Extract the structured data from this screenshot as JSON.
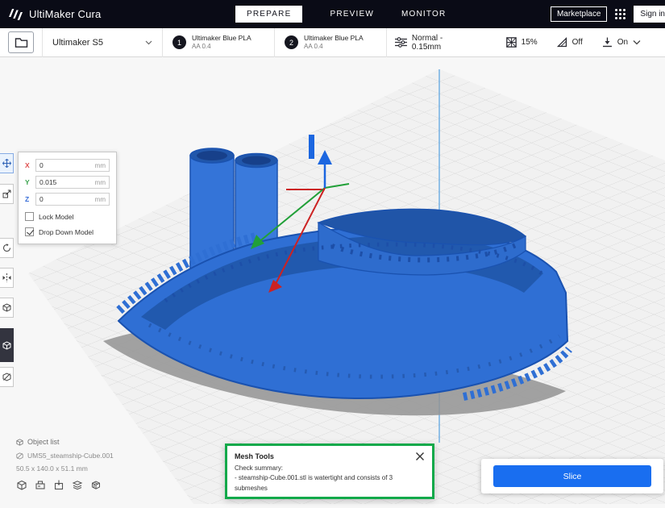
{
  "colors": {
    "accent": "#196ef0",
    "dialog_green": "#10a94a",
    "model_blue": "#2f6fd4",
    "header_bg": "#0a0b16"
  },
  "header": {
    "app_title": "UltiMaker Cura",
    "tabs": [
      {
        "label": "PREPARE",
        "active": true
      },
      {
        "label": "PREVIEW",
        "active": false
      },
      {
        "label": "MONITOR",
        "active": false
      }
    ],
    "marketplace_label": "Marketplace",
    "sign_in_label": "Sign in"
  },
  "toolbar": {
    "printer_name": "Ultimaker S5",
    "extruders": [
      {
        "number": "1",
        "material": "Ultimaker Blue PLA",
        "nozzle": "AA 0.4"
      },
      {
        "number": "2",
        "material": "Ultimaker Blue PLA",
        "nozzle": "AA 0.4"
      }
    ],
    "profile": "Normal - 0.15mm",
    "infill": "15%",
    "support": "Off",
    "adhesion": "On"
  },
  "move_panel": {
    "fields": [
      {
        "axis": "X",
        "value": "0",
        "unit": "mm"
      },
      {
        "axis": "Y",
        "value": "0.015",
        "unit": "mm"
      },
      {
        "axis": "Z",
        "value": "0",
        "unit": "mm"
      }
    ],
    "lock_model_label": "Lock Model",
    "drop_down_model_label": "Drop Down Model",
    "drop_down_checked": "checked"
  },
  "object_list": {
    "title": "Object list",
    "item_name": "UMS5_steamship-Cube.001",
    "dimensions": "50.5 x 140.0 x 51.1 mm"
  },
  "mesh_tools_dialog": {
    "title": "Mesh Tools",
    "summary_label": "Check summary:",
    "summary_line": "- steamship-Cube.001.stl is watertight and consists of 3 submeshes"
  },
  "slice_panel": {
    "slice_label": "Slice"
  },
  "icons": {
    "logo": "ultimaker-mark",
    "open_file": "folder",
    "profile": "sliders",
    "infill": "grid-square",
    "support": "overhang-triangle",
    "adhesion": "arrow-to-plate",
    "tools": [
      "move",
      "scale",
      "rotate",
      "mirror",
      "per-model-settings",
      "mesh-tools",
      "support-blocker"
    ],
    "dialog_close": "x"
  }
}
